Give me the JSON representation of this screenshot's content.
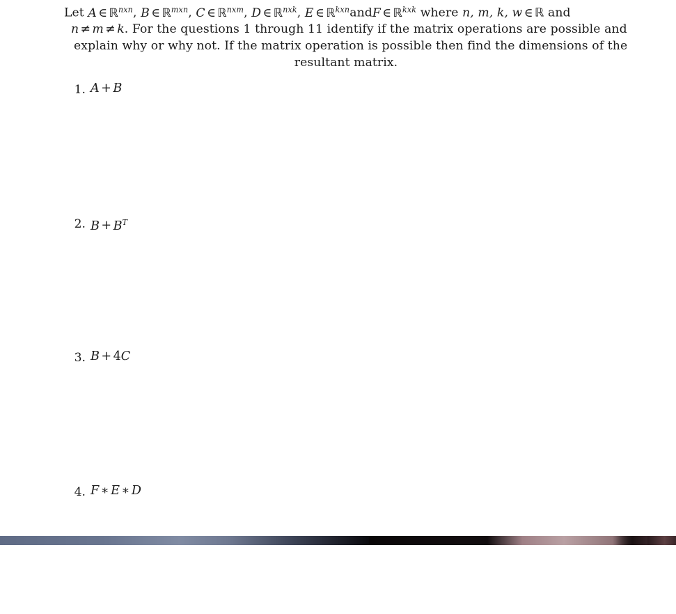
{
  "document": {
    "statement": {
      "line1_prefix": "Let ",
      "defs": [
        {
          "name": "A",
          "space": "R",
          "exponent": "nxn",
          "sep": ", "
        },
        {
          "name": "B",
          "space": "R",
          "exponent": "mxn",
          "sep": ", "
        },
        {
          "name": "C",
          "space": "R",
          "exponent": "nxm",
          "sep": ", "
        },
        {
          "name": "D",
          "space": "R",
          "exponent": "nxk",
          "sep": ", "
        },
        {
          "name": "E",
          "space": "R",
          "exponent": "kxn",
          "sep": "and"
        },
        {
          "name": "F",
          "space": "R",
          "exponent": "kxk",
          "sep": ""
        }
      ],
      "membership_symbol": "∈",
      "blackboard_R": "ℝ",
      "where_text": "where ",
      "scalars": "n, m, k, w",
      "scalars_tail": " and",
      "line2_constraint_lhs": "n",
      "neq_symbol": "≠",
      "line2_constraint_mid": "m",
      "line2_constraint_rhs": "k",
      "line2_text": ". For the questions 1 through 11 identify if the matrix operations are possible and",
      "line3_text": "explain why or why not. If the matrix operation is possible then find the dimensions of the",
      "line4_text": "resultant matrix."
    },
    "questions": [
      {
        "number": "1.",
        "expression": "A + B",
        "parts": [
          {
            "t": "A",
            "k": "var"
          },
          {
            "t": "+",
            "k": "op"
          },
          {
            "t": "B",
            "k": "var"
          }
        ]
      },
      {
        "number": "2.",
        "expression": "B + B^T",
        "parts": [
          {
            "t": "B",
            "k": "var"
          },
          {
            "t": "+",
            "k": "op"
          },
          {
            "t": "B",
            "k": "var"
          },
          {
            "t": "T",
            "k": "sup"
          }
        ]
      },
      {
        "number": "3.",
        "expression": "B + 4C",
        "parts": [
          {
            "t": "B",
            "k": "var"
          },
          {
            "t": "+",
            "k": "op"
          },
          {
            "t": "4",
            "k": "num"
          },
          {
            "t": "C",
            "k": "var"
          }
        ]
      },
      {
        "number": "4.",
        "expression": "F * E * D",
        "parts": [
          {
            "t": "F",
            "k": "var"
          },
          {
            "t": "∗",
            "k": "op"
          },
          {
            "t": "E",
            "k": "var"
          },
          {
            "t": "∗",
            "k": "op"
          },
          {
            "t": "D",
            "k": "var"
          }
        ]
      }
    ]
  },
  "bottom_strip": {
    "description": "partially visible window below the document",
    "colors": {
      "blue_gray": "#6e7890",
      "dark": "#0d0a0b",
      "mauve": "#b9a0a3"
    }
  },
  "colors": {
    "page_background": "#ffffff",
    "text": "#1c1c1c"
  }
}
